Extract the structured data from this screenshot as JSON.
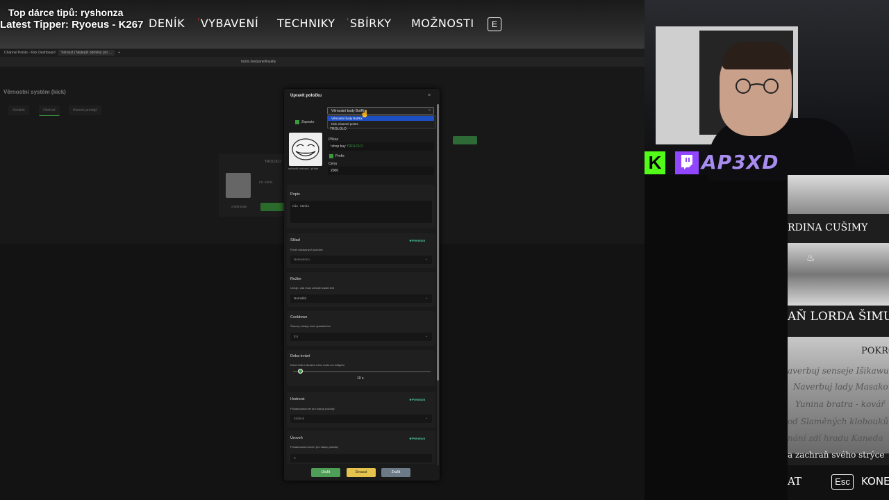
{
  "overlay": {
    "tipper_top": "Top dárce tipů: ryshonza",
    "tipper_latest": "Latest Tipper: Ryoeus - K267"
  },
  "game_menu": {
    "items": [
      "DENÍK",
      "VYBAVENÍ",
      "TECHNIKY",
      "SBÍRKY",
      "MOŽNOSTI"
    ],
    "esc": "E"
  },
  "browser": {
    "tabs": [
      "Channel Points - Kick Dashboard",
      "Věrnost | Nejlepší odměny pro ..."
    ],
    "url": "botrix.live/panel/loyalty"
  },
  "page": {
    "title": "Věrnostní systém (kick)",
    "tabs": [
      "Začátek",
      "Obchod",
      "Historie prodejů"
    ],
    "item_name": "TROLOLO",
    "item_price": "2,000 body",
    "item_desc": "nic vonic"
  },
  "modal": {
    "title": "Upravit položku",
    "close": "×",
    "currency_select": "Věrnostní body BotRix",
    "currency_options": [
      "Věrnostní body BotRix",
      "Kick channel points"
    ],
    "enabled_label": "Zapnuto",
    "item_title": "TROLOLO",
    "image_caption": "nahradit obrázek / přidat",
    "command_label": "Příkaz",
    "command_prefix": "!shop buy ",
    "command_value": "TROLOLO",
    "prefix_label": "Prefix",
    "price_label": "Cena",
    "price_value": "2000",
    "description_label": "Popis",
    "description_value": "nic vonic",
    "stock": {
      "label": "Sklad",
      "premium": "Premium",
      "desc": "Počet dostupných položek",
      "value": "Nekonečno"
    },
    "mode": {
      "label": "Režim",
      "desc": "Určuje, zda musí uživatel zadat text",
      "value": "Normální"
    },
    "cooldown": {
      "label": "Cooldown",
      "desc": "Časový odstup mezi uplatněními",
      "value": "3 s"
    },
    "duration": {
      "label": "Doba trvání",
      "desc": "Doba trvání obrázku nebo zvuku ve widgetu",
      "value": "10 s",
      "level": 0.05
    },
    "rank": {
      "label": "Hodnost",
      "premium": "Premium",
      "desc": "Požadovaná role pro nákup položky",
      "value": "Kdokoli"
    },
    "level": {
      "label": "Úroveň",
      "premium": "Premium",
      "desc": "Požadovaná úroveň pro nákup položky",
      "value": "0"
    },
    "buttons": {
      "save": "Uložit",
      "delete": "Smazat",
      "cancel": "Zrušit"
    }
  },
  "stream": {
    "brand": "AP3XD",
    "kick": "K"
  },
  "game_right": {
    "title1": "RDINA CUŠIMY",
    "title2": "AŇ LORDA ŠIMUR",
    "title3": "POKRO",
    "list": [
      "averbuj senseje Išikawu",
      "Naverbuj lady Masako",
      "Yunina bratra - kovář",
      "od Slaměných klobouků",
      "nání zdí hradu Kaneda",
      "a zachraň svého strýce"
    ],
    "bottom_left": "AT",
    "esc": "Esc",
    "bottom_right": "KONE"
  }
}
